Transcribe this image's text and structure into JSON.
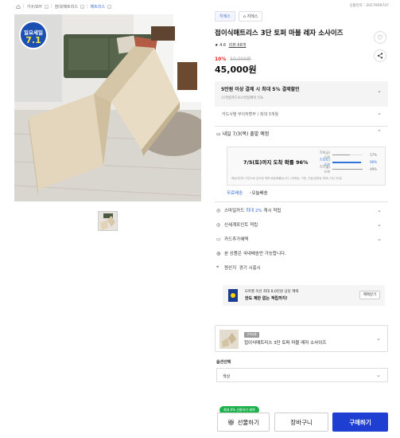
{
  "breadcrumbs": {
    "home_icon": "home-icon",
    "items": [
      "가구/DIY",
      "침대/매트리스",
      "매트리스"
    ],
    "product_code": "상품번호 : 2017909747"
  },
  "badge": {
    "line1": "일요세일",
    "line2": "7.1"
  },
  "store": {
    "tab1": "지에스",
    "tab2": "지에스"
  },
  "product": {
    "title": "접이식매트리스 3단 토퍼 마블 레자 소사이즈",
    "rating": "4.6",
    "review_link": "리뷰 68개",
    "discount": "10%",
    "original_price": "50,000원",
    "price": "45,000원"
  },
  "benefit": {
    "title": "5만원 이상 결제 시 최대 5% 결제할인",
    "sub": "스마일카드X스마일페이 5%",
    "card_row": "카드사별 무이자할부 / 최대 3개월"
  },
  "shipping": {
    "head": "내일 7/3(목) 출발 예정",
    "arrival": "7/5(토)까지 도착 확률 96%",
    "bars": [
      {
        "label": "7/4(금) 도착",
        "pct": "57%",
        "value": 57,
        "highlight": false
      },
      {
        "label": "7/5(토) 도착",
        "pct": "96%",
        "value": 96,
        "highlight": true
      },
      {
        "label": "7/7(월) 도착",
        "pct": "99%",
        "value": 99,
        "highlight": false
      }
    ],
    "note": "배송데이터 기반으로 분석된 예측 배송확률입니다. (판매일, 기준, 주말/공휴일 제외) 지난 30일",
    "tab_free": "무료배송",
    "tab_other": "오늘배송"
  },
  "rows": {
    "smile_prefix": "스마일카드",
    "smile_highlight": "최대 2%",
    "smile_suffix": "캐시 적립",
    "points": "신세계포인트 적립",
    "card_extra": "카드추가혜택",
    "domestic": "본 상품은 국내배송만 가능합니다.",
    "origin_label": "원산지",
    "origin_value": "경기 시흥시"
  },
  "promo": {
    "line1": "G마켓 옥션 최대 8,0만원 상당 혜택",
    "line2": "한도 제한 없는 적립까지!",
    "button": "혜택받기"
  },
  "option_card": {
    "tag": "선택상품",
    "title": "접이식매트리스 3단 토퍼 마블 레자 소사이즈"
  },
  "option": {
    "label": "옵션선택",
    "selected": "색상"
  },
  "buttons": {
    "gift_pill": "최대 6% 선물하기 혜택",
    "gift": "선물하기",
    "cart": "장바구니",
    "buy": "구매하기"
  },
  "colors": {
    "accent": "#1e3fd1",
    "discount": "#e02424",
    "green": "#1db14b"
  }
}
